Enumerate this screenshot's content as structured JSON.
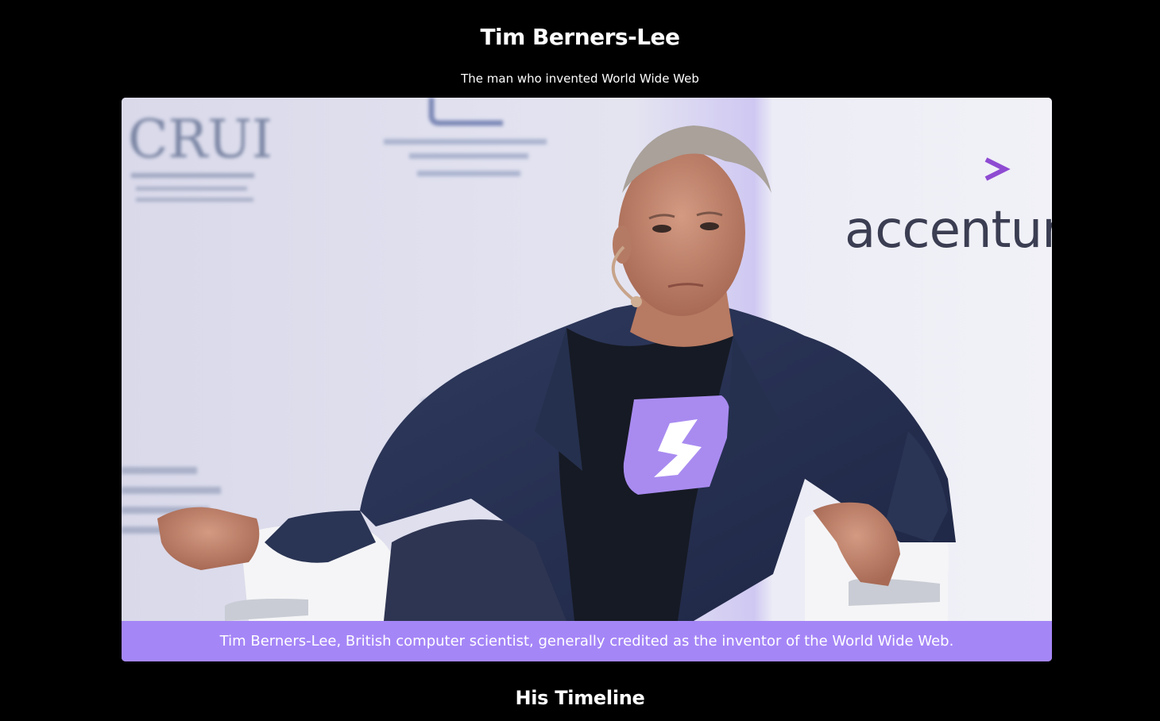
{
  "header": {
    "title": "Tim Berners-Lee",
    "subtitle": "The man who invented World Wide Web"
  },
  "figure": {
    "image_alt": "Tim Berners-Lee seated on stage",
    "caption": "Tim Berners-Lee, British computer scientist, generally credited as the inventor of the World Wide Web.",
    "backdrop_texts": {
      "crui": "CRUI",
      "accenture": "accentur"
    },
    "accent_color": "#a586f7"
  },
  "timeline": {
    "heading": "His Timeline"
  },
  "colors": {
    "background": "#000000",
    "text": "#ffffff",
    "caption_bg": "#a586f7"
  }
}
